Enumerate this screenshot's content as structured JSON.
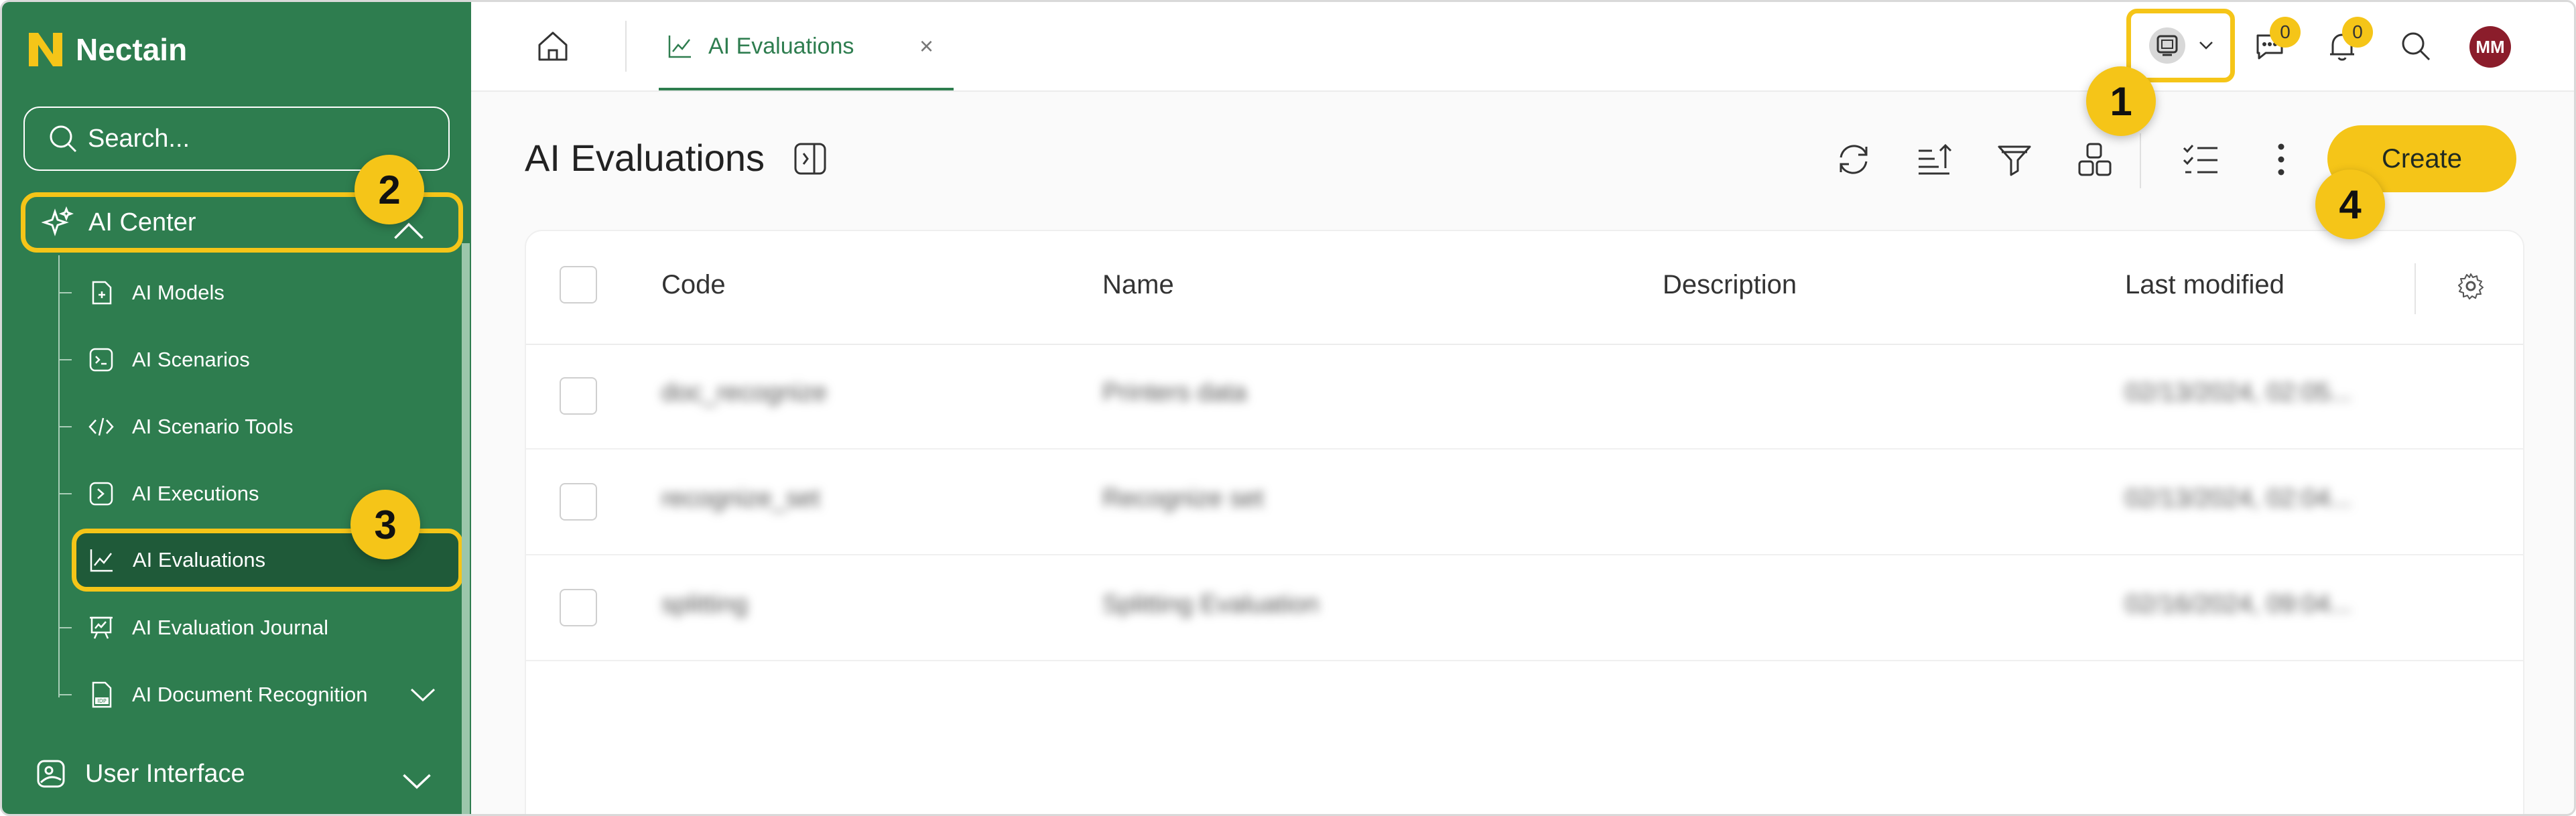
{
  "app": {
    "name": "Nectain"
  },
  "colors": {
    "sidebar_bg": "#2e7d4f",
    "accent": "#f5c518",
    "avatar_bg": "#8b1d2b"
  },
  "sidebar": {
    "search_placeholder": "Search...",
    "section_ai_center": "AI Center",
    "items": [
      {
        "label": "AI Models",
        "icon": "document-plus-icon"
      },
      {
        "label": "AI Scenarios",
        "icon": "terminal-icon"
      },
      {
        "label": "AI Scenario Tools",
        "icon": "code-icon"
      },
      {
        "label": "AI Executions",
        "icon": "execute-icon"
      },
      {
        "label": "AI Evaluations",
        "icon": "chart-line-icon",
        "active": true
      },
      {
        "label": "AI Evaluation Journal",
        "icon": "presentation-icon"
      },
      {
        "label": "AI Document Recognition",
        "icon": "idp-document-icon"
      }
    ],
    "section_user_interface": "User Interface"
  },
  "topbar": {
    "tab_label": "AI Evaluations",
    "tab_close": "×",
    "messages_count": "0",
    "notifications_count": "0",
    "avatar_initials": "MM"
  },
  "page": {
    "title": "AI Evaluations",
    "create_label": "Create"
  },
  "table": {
    "columns": [
      "Code",
      "Name",
      "Description",
      "Last modified"
    ],
    "rows": [
      {
        "code": "doc_recognize",
        "name": "Printers data",
        "description": "",
        "modified": "02/13/2024, 02:05..."
      },
      {
        "code": "recognize_set",
        "name": "Recognize set",
        "description": "",
        "modified": "02/13/2024, 02:04..."
      },
      {
        "code": "splitting",
        "name": "Splitting Evaluation",
        "description": "",
        "modified": "02/16/2024, 09:04..."
      }
    ]
  },
  "markers": [
    "1",
    "2",
    "3",
    "4"
  ]
}
